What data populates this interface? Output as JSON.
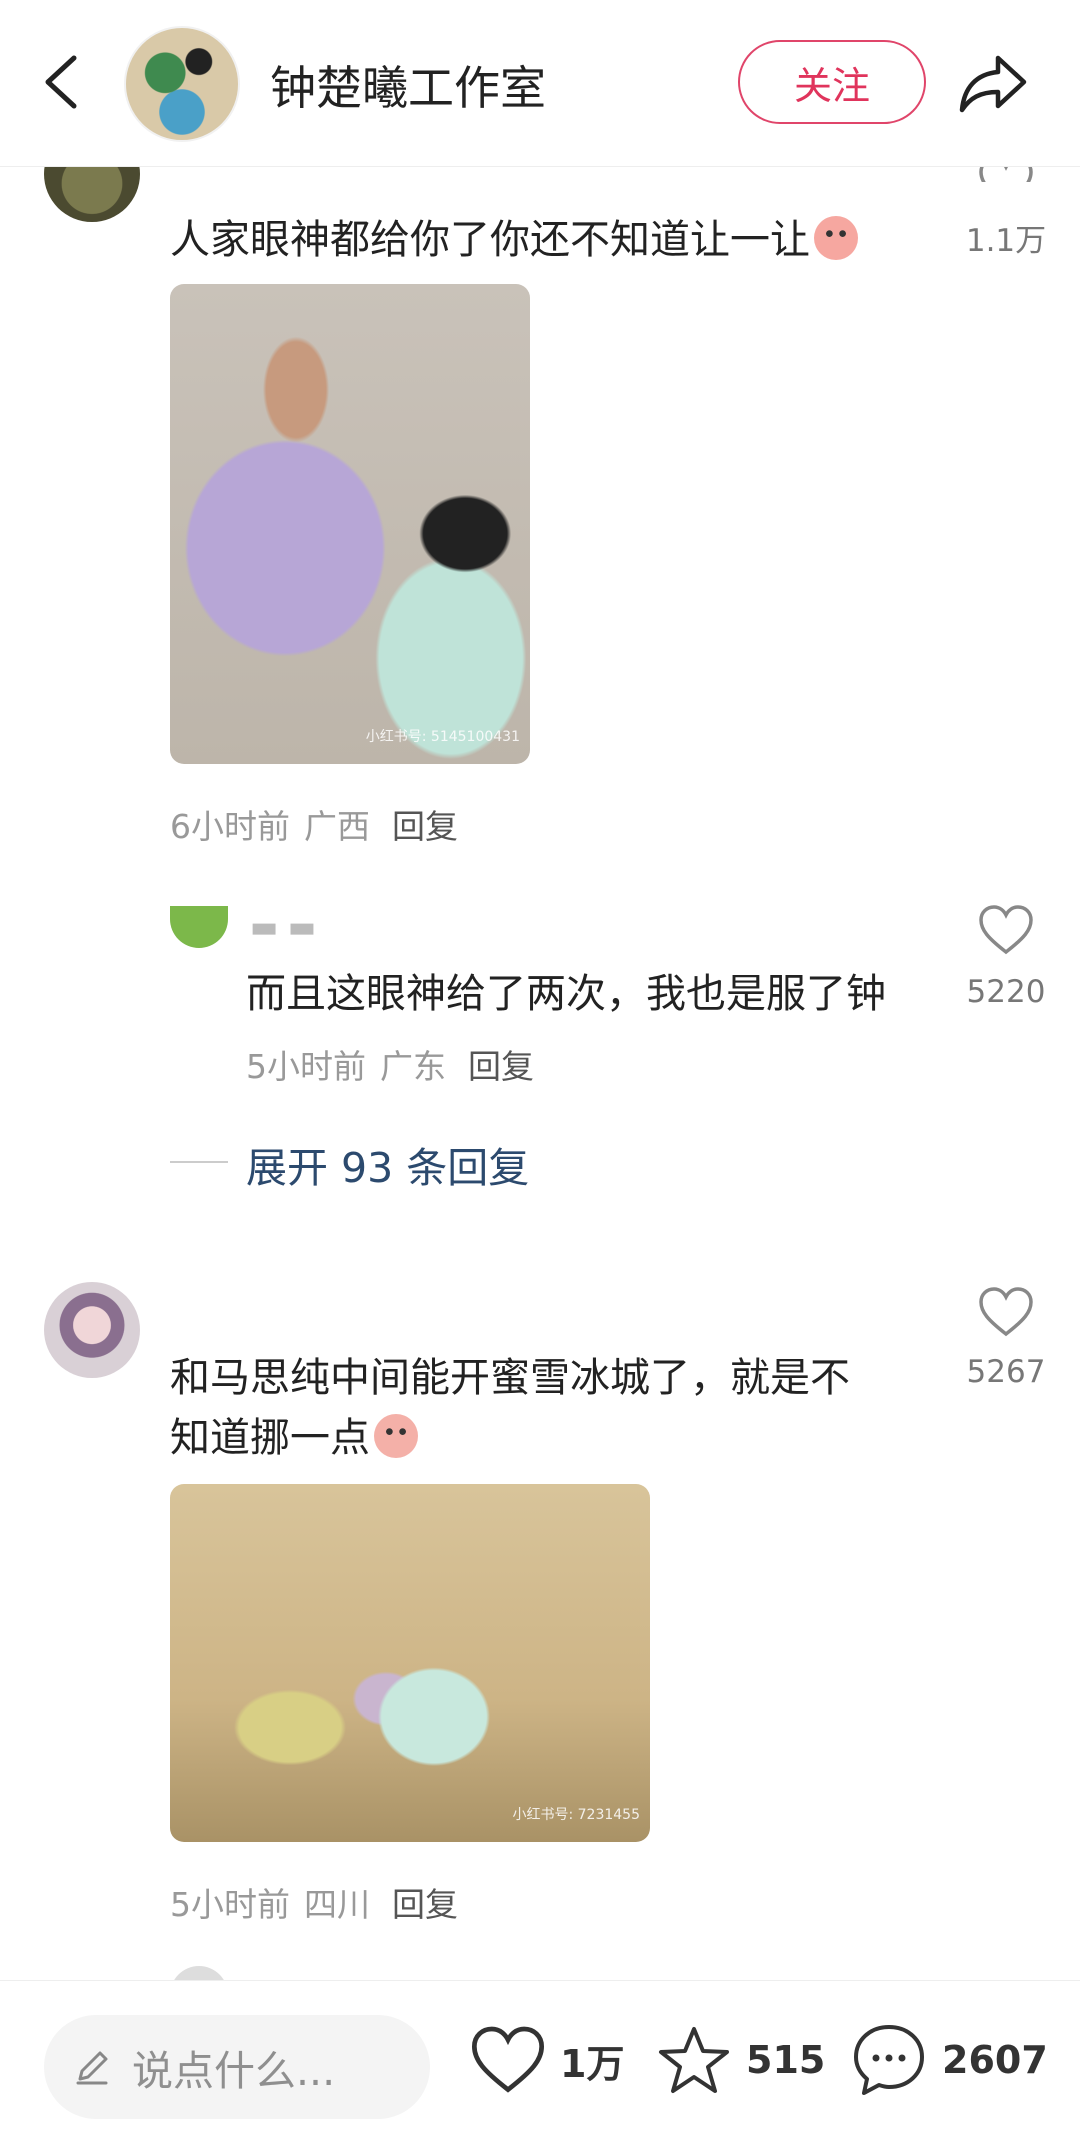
{
  "header": {
    "title": "钟楚曦工作室",
    "follow_label": "关注"
  },
  "comments": [
    {
      "text": "人家眼神都给你了你还不知道让一让",
      "likes": "1.1万",
      "time": "6小时前",
      "location": "广西",
      "reply_label": "回复",
      "image_watermark": "小红书号: 5145100431"
    },
    {
      "text_line1": "和马思纯中间能开蜜雪冰城了，就是不",
      "text_line2": "知道挪一点",
      "likes": "5267",
      "time": "5小时前",
      "location": "四川",
      "reply_label": "回复",
      "image_watermark": "小红书号: 7231455"
    }
  ],
  "reply": {
    "text": "而且这眼神给了两次，我也是服了钟",
    "likes": "5220",
    "time": "5小时前",
    "location": "广东",
    "reply_label": "回复"
  },
  "expand": {
    "label": "展开 93 条回复"
  },
  "bottom_bar": {
    "input_placeholder": "说点什么...",
    "likes": "1万",
    "favorites": "515",
    "comments": "2607"
  },
  "colors": {
    "accent": "#e0345c",
    "link": "#2c4a6e"
  }
}
